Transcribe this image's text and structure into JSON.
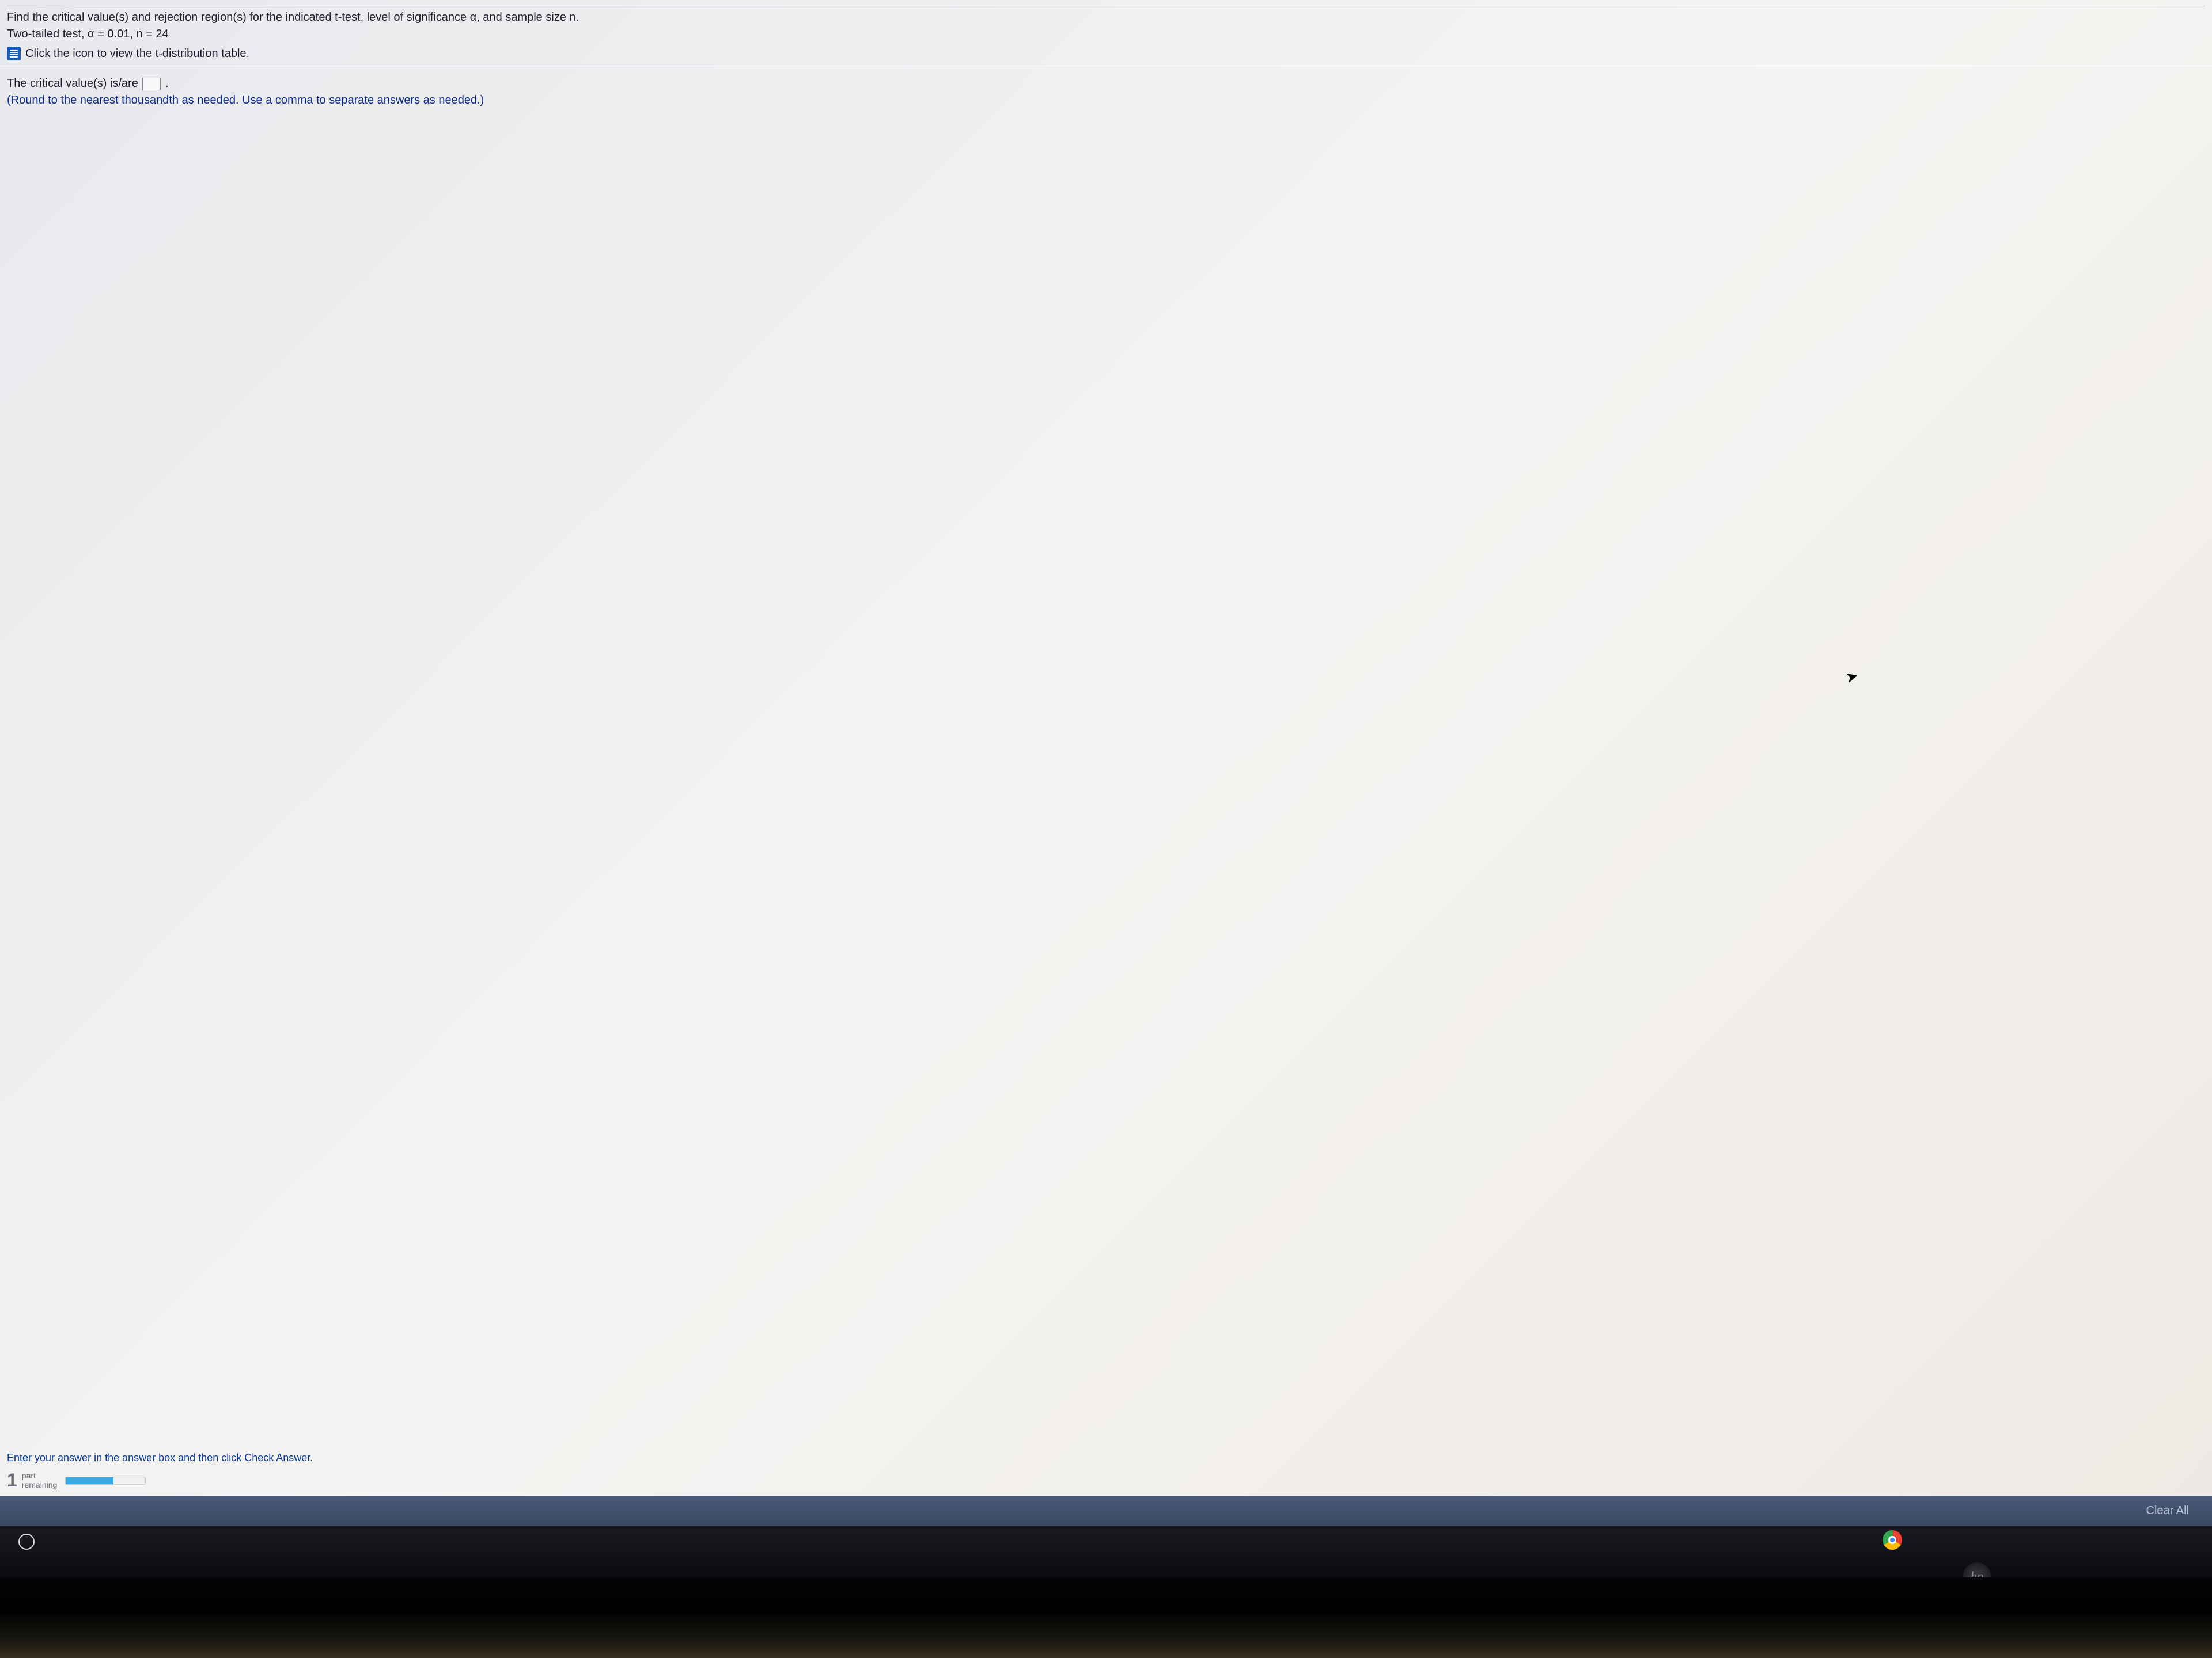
{
  "question": {
    "line1": "Find the critical value(s) and rejection region(s) for the indicated t-test, level of significance α, and sample size n.",
    "line2": "Two-tailed test, α = 0.01, n = 24",
    "icon_label": "Click the icon to view the t-distribution table."
  },
  "answer_section": {
    "prompt_prefix": "The critical value(s) is/are ",
    "prompt_suffix": ".",
    "hint": "(Round to the nearest thousandth as needed. Use a comma to separate answers as needed.)"
  },
  "footer": {
    "instruction": "Enter your answer in the answer box and then click Check Answer.",
    "parts_number": "1",
    "parts_word": "part",
    "remaining_word": "remaining"
  },
  "actions": {
    "clear_all": "Clear All"
  },
  "logos": {
    "hp": "hp"
  }
}
